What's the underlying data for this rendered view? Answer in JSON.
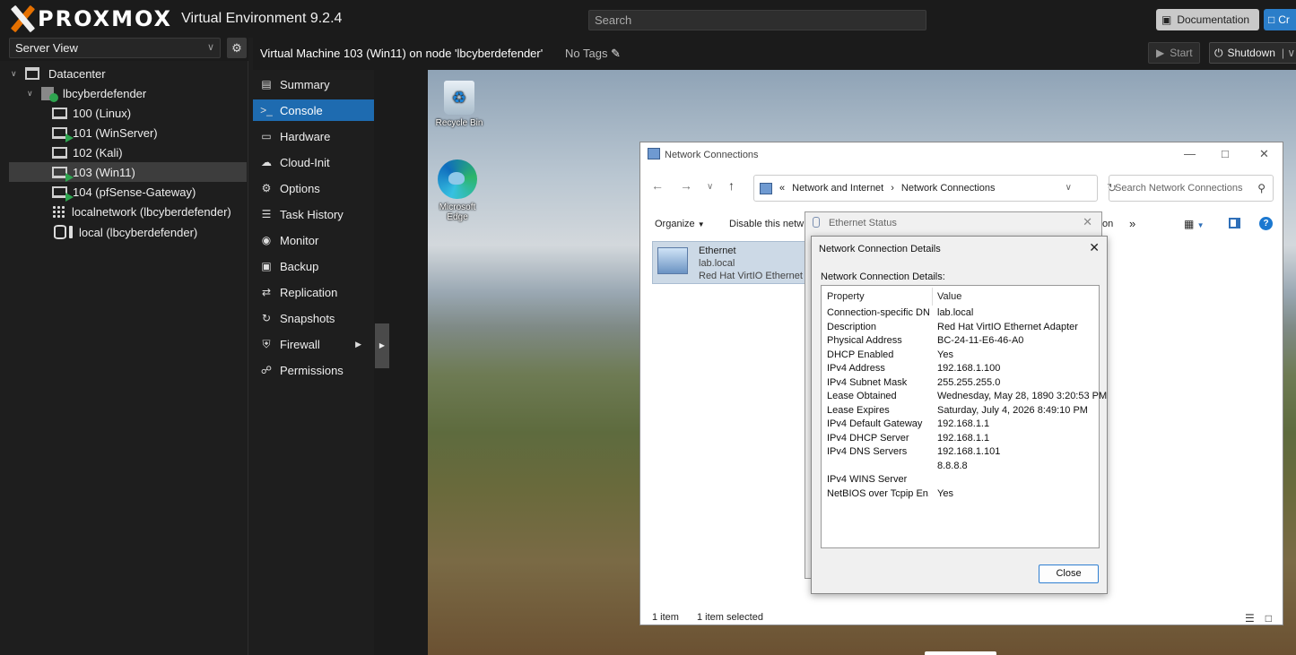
{
  "app": {
    "brand": "PROXMOX",
    "version": "Virtual Environment 9.2.4",
    "search_placeholder": "Search",
    "documentation_label": "Documentation",
    "create_label": "Cr"
  },
  "tree": {
    "view_label": "Server View",
    "nodes": [
      {
        "label": "Datacenter"
      },
      {
        "label": "lbcyberdefender"
      },
      {
        "label": "100 (Linux)"
      },
      {
        "label": "101 (WinServer)"
      },
      {
        "label": "102 (Kali)"
      },
      {
        "label": "103 (Win11)"
      },
      {
        "label": "104 (pfSense-Gateway)"
      },
      {
        "label": "localnetwork (lbcyberdefender)"
      },
      {
        "label": "local (lbcyberdefender)"
      }
    ]
  },
  "vm": {
    "title": "Virtual Machine 103 (Win11) on node 'lbcyberdefender'",
    "tags": "No Tags",
    "start_label": "Start",
    "shutdown_label": "Shutdown"
  },
  "menu": [
    {
      "label": "Summary"
    },
    {
      "label": "Console"
    },
    {
      "label": "Hardware"
    },
    {
      "label": "Cloud-Init"
    },
    {
      "label": "Options"
    },
    {
      "label": "Task History"
    },
    {
      "label": "Monitor"
    },
    {
      "label": "Backup"
    },
    {
      "label": "Replication"
    },
    {
      "label": "Snapshots"
    },
    {
      "label": "Firewall"
    },
    {
      "label": "Permissions"
    }
  ],
  "desktop": {
    "recycle_bin": "Recycle Bin",
    "edge": "Microsoft Edge"
  },
  "explorer": {
    "title": "Network Connections",
    "breadcrumb_prefix": "«",
    "breadcrumb": [
      "Network and Internet",
      "Network Connections"
    ],
    "search_placeholder": "Search Network Connections",
    "organize": "Organize",
    "disable": "Disable this netw",
    "toolbar_tail": "on",
    "more": "»",
    "item": {
      "name": "Ethernet",
      "network": "lab.local",
      "adapter": "Red Hat VirtIO Ethernet A"
    },
    "status_count": "1 item",
    "status_selected": "1 item selected"
  },
  "eth_status": {
    "title": "Ethernet Status"
  },
  "details": {
    "title": "Network Connection Details",
    "label": "Network Connection Details:",
    "header_property": "Property",
    "header_value": "Value",
    "rows": [
      {
        "p": "Connection-specific DN...",
        "v": "lab.local"
      },
      {
        "p": "Description",
        "v": "Red Hat VirtIO Ethernet Adapter"
      },
      {
        "p": "Physical Address",
        "v": "BC-24-11-E6-46-A0"
      },
      {
        "p": "DHCP Enabled",
        "v": "Yes"
      },
      {
        "p": "IPv4 Address",
        "v": "192.168.1.100"
      },
      {
        "p": "IPv4 Subnet Mask",
        "v": "255.255.255.0"
      },
      {
        "p": "Lease Obtained",
        "v": "Wednesday, May 28, 1890 3:20:53 PM"
      },
      {
        "p": "Lease Expires",
        "v": "Saturday, July 4, 2026 8:49:10 PM"
      },
      {
        "p": "IPv4 Default Gateway",
        "v": "192.168.1.1"
      },
      {
        "p": "IPv4 DHCP Server",
        "v": "192.168.1.1"
      },
      {
        "p": "IPv4 DNS Servers",
        "v": "192.168.1.101"
      },
      {
        "p": "",
        "v": "8.8.8.8"
      },
      {
        "p": "IPv4 WINS Server",
        "v": ""
      },
      {
        "p": "NetBIOS over Tcpip En...",
        "v": "Yes"
      }
    ],
    "close_label": "Close"
  },
  "colors": {
    "accent": "#1e6bb0",
    "logo_orange": "#e57000",
    "running_green": "#2ea44f"
  }
}
